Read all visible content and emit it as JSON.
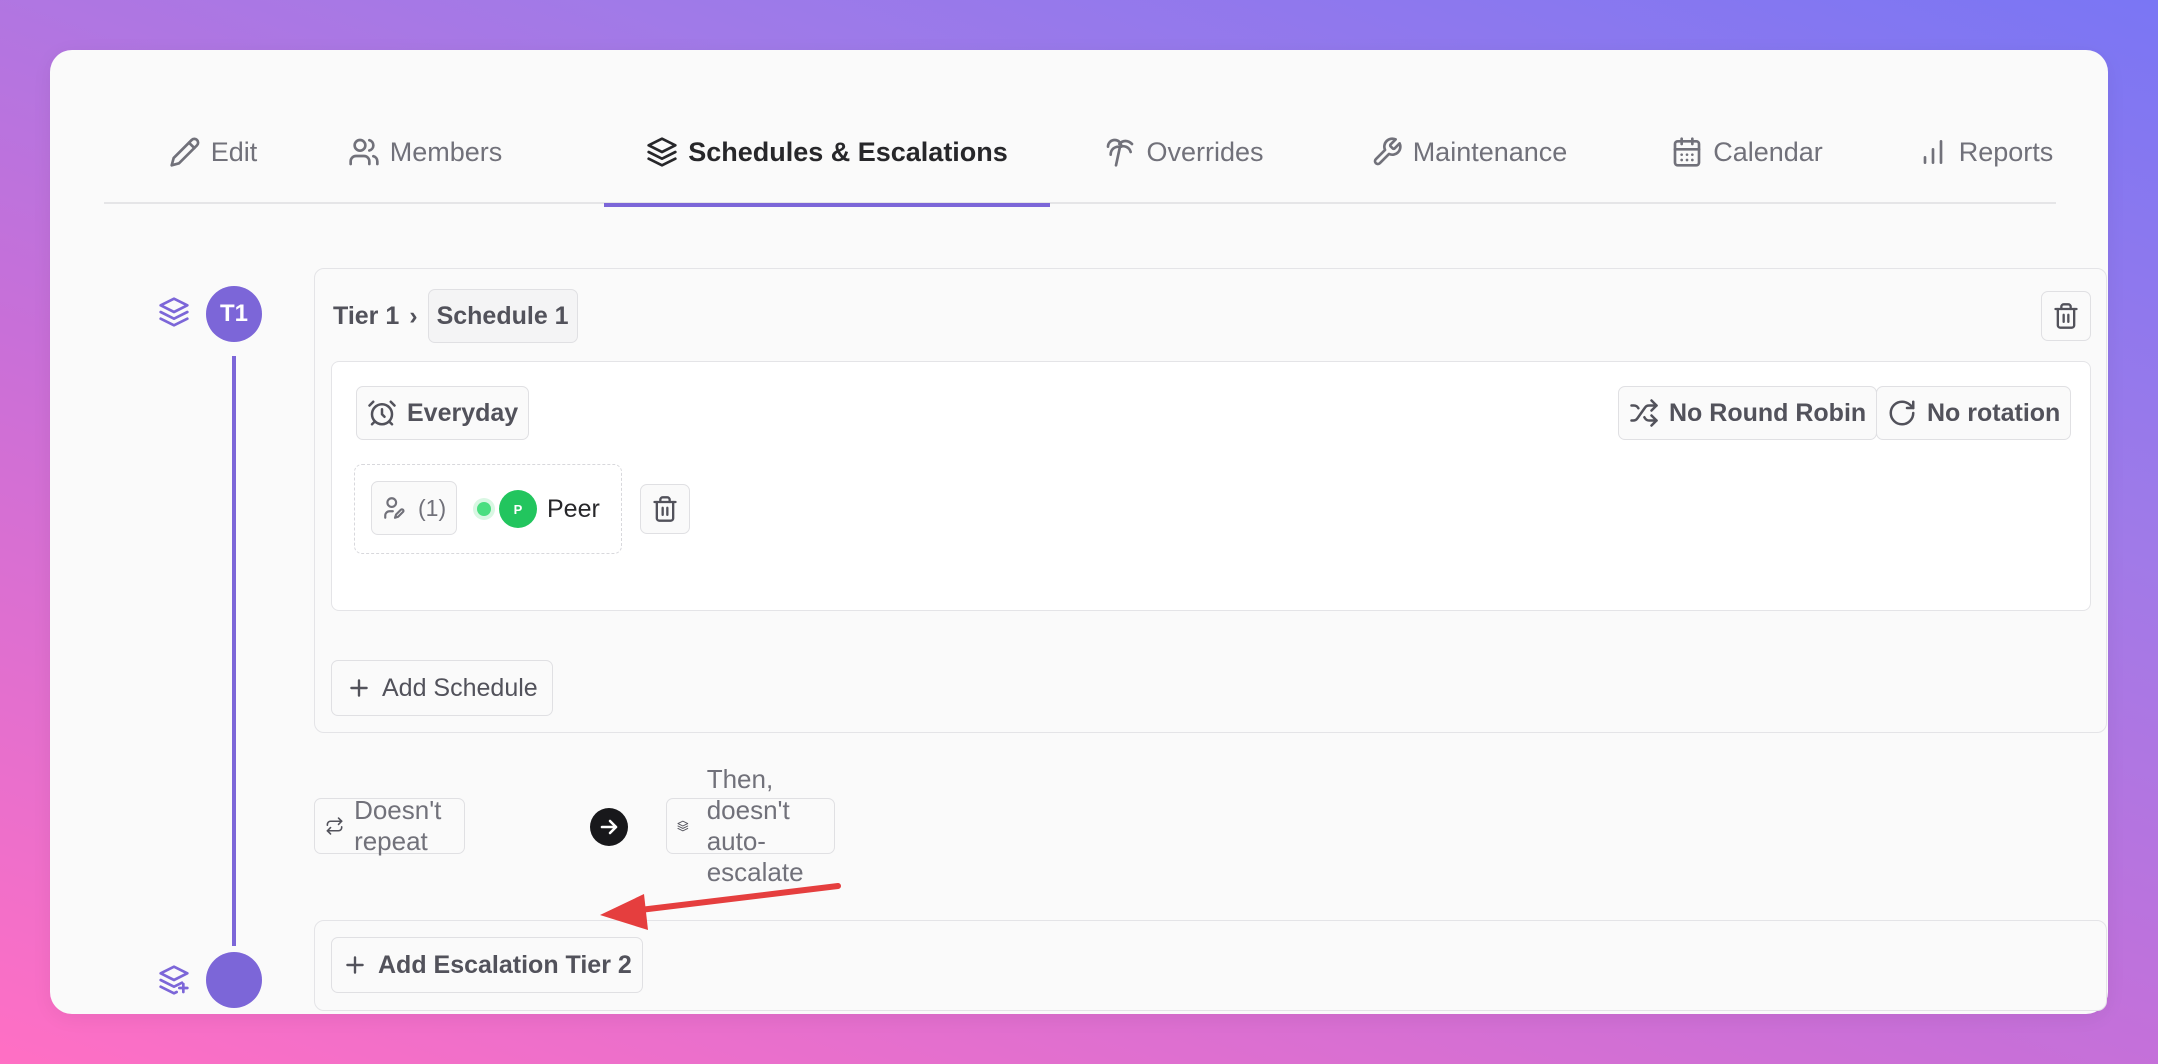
{
  "tabs": [
    {
      "label": "Edit",
      "icon": "pencil-icon"
    },
    {
      "label": "Members",
      "icon": "users-icon"
    },
    {
      "label": "Schedules & Escalations",
      "icon": "layers-icon",
      "active": true
    },
    {
      "label": "Overrides",
      "icon": "palm-tree-icon"
    },
    {
      "label": "Maintenance",
      "icon": "wrench-icon"
    },
    {
      "label": "Calendar",
      "icon": "calendar-icon"
    },
    {
      "label": "Reports",
      "icon": "bar-chart-icon"
    }
  ],
  "timeline": {
    "tier1_badge": "T1"
  },
  "tier": {
    "crumb_label": "Tier 1",
    "crumb_separator": "›",
    "schedule_name": "Schedule 1",
    "schedule": {
      "time_label": "Everyday",
      "round_robin_label": "No Round Robin",
      "rotation_label": "No rotation",
      "member_count": "(1)",
      "members": [
        {
          "initial": "P",
          "name": "Peer",
          "status_color": "#4ade80",
          "avatar_color": "#22c55e"
        }
      ]
    },
    "add_schedule_label": "Add Schedule"
  },
  "escalation": {
    "repeat_label": "Doesn't repeat",
    "then_label": "Then, doesn't auto-escalate"
  },
  "add_tier_label": "Add Escalation Tier 2",
  "colors": {
    "accent": "#7c66d8",
    "annotation_arrow": "#e53e3e"
  }
}
